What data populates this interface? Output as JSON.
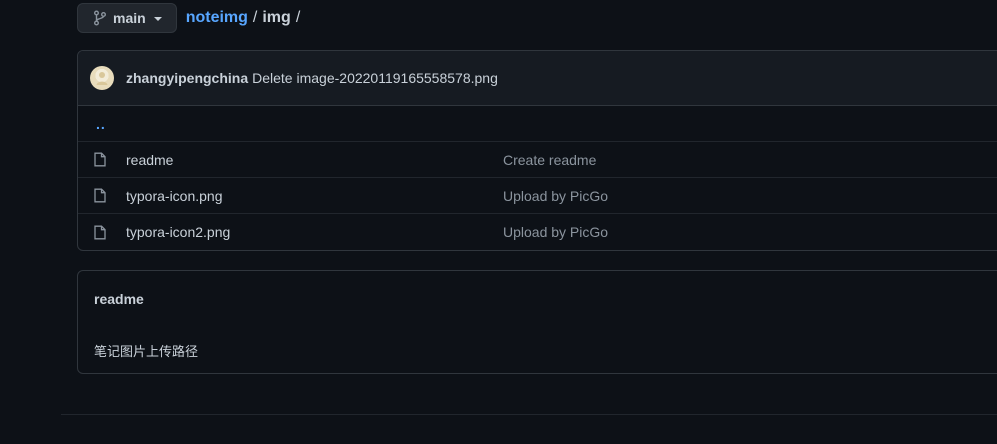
{
  "branch": {
    "name": "main"
  },
  "breadcrumb": {
    "repo": "noteimg",
    "sep1": "/",
    "dir": "img",
    "sep2": "/"
  },
  "commit": {
    "author": "zhangyipengchina",
    "message": "Delete image-20220119165558578.png"
  },
  "files": {
    "updir": "..",
    "rows": [
      {
        "name": "readme",
        "commit": "Create readme"
      },
      {
        "name": "typora-icon.png",
        "commit": "Upload by PicGo"
      },
      {
        "name": "typora-icon2.png",
        "commit": "Upload by PicGo"
      }
    ]
  },
  "readme": {
    "title": "readme",
    "body": "笔记图片上传路径"
  },
  "colors": {
    "background": "#0d1117",
    "link": "#58a6ff",
    "border": "#30363d",
    "muted": "#8b949e"
  },
  "icons": {
    "branch": "git-branch-icon",
    "file": "file-icon",
    "caret": "chevron-down-icon"
  }
}
